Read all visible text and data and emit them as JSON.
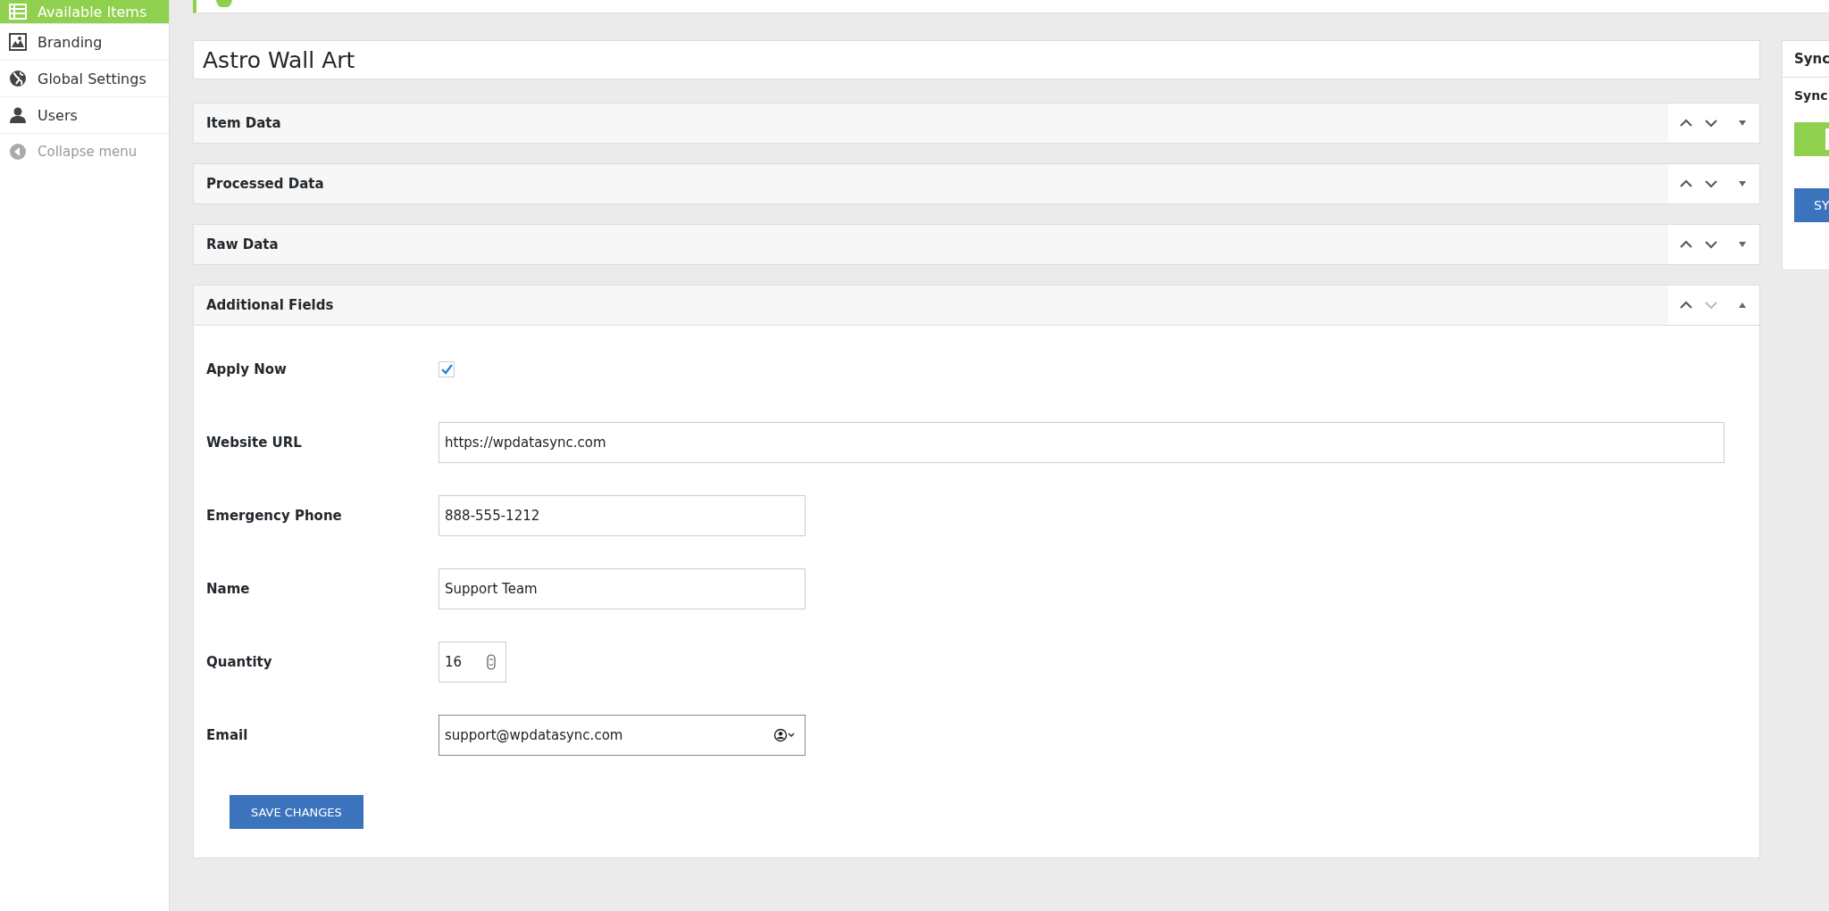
{
  "sidebar": {
    "items": [
      {
        "label": "Available Items",
        "selected": true
      },
      {
        "label": "Branding",
        "selected": false
      },
      {
        "label": "Global Settings",
        "selected": false
      },
      {
        "label": "Users",
        "selected": false
      },
      {
        "label": "Collapse menu",
        "selected": false
      }
    ]
  },
  "title_field": {
    "value": "Astro Wall Art"
  },
  "panels": [
    {
      "title": "Item Data",
      "expanded": false,
      "move_down_disabled": false
    },
    {
      "title": "Processed Data",
      "expanded": false,
      "move_down_disabled": false
    },
    {
      "title": "Raw Data",
      "expanded": false,
      "move_down_disabled": false
    },
    {
      "title": "Additional Fields",
      "expanded": true,
      "move_down_disabled": true
    }
  ],
  "fields": [
    {
      "label": "Apply Now",
      "kind": "checkbox",
      "checked": true
    },
    {
      "label": "Website URL",
      "kind": "url",
      "value": "https://wpdatasync.com",
      "focused": false
    },
    {
      "label": "Emergency Phone",
      "kind": "text",
      "value": "888-555-1212",
      "focused": false
    },
    {
      "label": "Name",
      "kind": "text",
      "value": "Support Team",
      "focused": false
    },
    {
      "label": "Quantity",
      "kind": "number",
      "value": "16",
      "focused": false
    },
    {
      "label": "Email",
      "kind": "email",
      "value": "support@wpdatasync.com",
      "focused": true
    }
  ],
  "save_button": {
    "label": "SAVE CHANGES"
  },
  "sync_panel": {
    "title": "Sync",
    "text": "Sync",
    "button": "SY"
  }
}
